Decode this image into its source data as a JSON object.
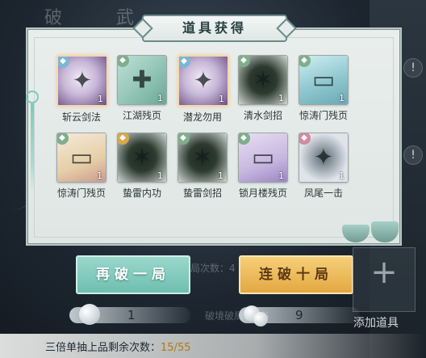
{
  "background": {
    "faded_title": "破 武"
  },
  "panel": {
    "title": "道具获得"
  },
  "items": [
    {
      "name": "斩云剑法",
      "count": "1",
      "art": "violet",
      "glyph": "✦",
      "badge": "blue",
      "selected": true
    },
    {
      "name": "江湖残页",
      "count": "1",
      "art": "green",
      "glyph": "✚",
      "badge": "green"
    },
    {
      "name": "潜龙勿用",
      "count": "1",
      "art": "violet",
      "glyph": "✦",
      "badge": "blue",
      "selected": true
    },
    {
      "name": "清水剑招",
      "count": "1",
      "art": "dark",
      "glyph": "✶",
      "badge": "green"
    },
    {
      "name": "惊涛门残页",
      "count": "1",
      "art": "scroll-blue",
      "glyph": "▭",
      "badge": "green"
    },
    {
      "name": "惊涛门残页",
      "count": "1",
      "art": "scroll-red",
      "glyph": "▭",
      "badge": "green"
    },
    {
      "name": "蛰雷内功",
      "count": "1",
      "art": "dark",
      "glyph": "✶",
      "badge": "gold"
    },
    {
      "name": "蛰雷剑招",
      "count": "1",
      "art": "dark",
      "glyph": "✶",
      "badge": "green"
    },
    {
      "name": "锁月楼残页",
      "count": "1",
      "art": "scroll-purple",
      "glyph": "▭",
      "badge": "green"
    },
    {
      "name": "凤尾一击",
      "count": "1",
      "art": "pale",
      "glyph": "✦",
      "badge": "pink"
    }
  ],
  "buttons": {
    "again": "再破一局",
    "ten": "连破十局"
  },
  "ghost_texts": {
    "behind_buttons": "局次数：4",
    "behind_currency": "破境破局5次必"
  },
  "add_item": {
    "label": "添加道具"
  },
  "currency": [
    {
      "value": "1"
    },
    {
      "value": "9"
    }
  ],
  "footer": {
    "text": "三倍单抽上品剩余次数：",
    "count": "15/55"
  },
  "colors": {
    "badge_blue": "#7bb6d6",
    "badge_green": "#7fae8c",
    "badge_gold": "#d9a84a",
    "badge_pink": "#d48aa0"
  }
}
